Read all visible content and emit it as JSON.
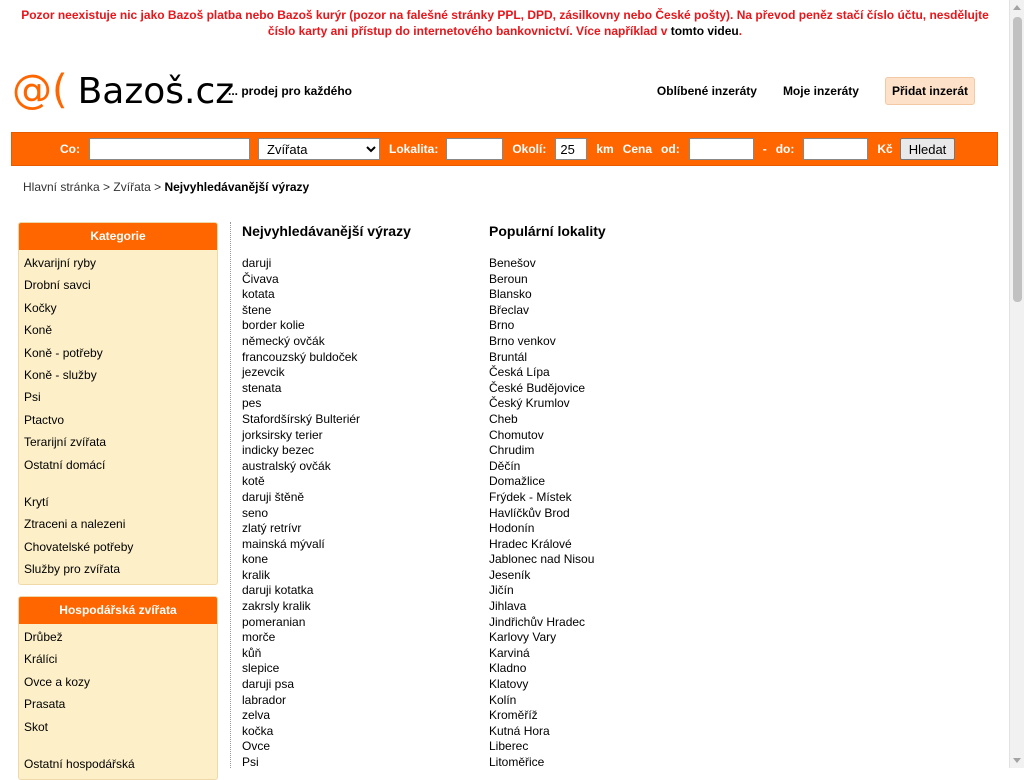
{
  "warning": {
    "text": "Pozor neexistuje nic jako Bazoš platba nebo Bazoš kurýr (pozor na falešné stránky PPL, DPD, zásilkovny nebo České pošty). Na převod peněz stačí číslo účtu, nesdělujte číslo karty ani přístup do internetového bankovnictví. Více například v",
    "link": "tomto videu",
    "end": "."
  },
  "header": {
    "logo_at": "@(",
    "logo_text": "Bazoš.cz",
    "tagline": "... prodej pro každého",
    "nav": {
      "favorites": "Oblíbené inzeráty",
      "my_ads": "Moje inzeráty",
      "add_ad": "Přidat inzerát"
    }
  },
  "search": {
    "what_label": "Co:",
    "what_value": "",
    "category_selected": "Zvířata",
    "location_label": "Lokalita:",
    "location_value": "",
    "radius_label": "Okolí:",
    "radius_value": "25",
    "km_label": "km",
    "price_label": "Cena",
    "from_label": "od:",
    "from_value": "",
    "dash": "-",
    "to_label": "do:",
    "to_value": "",
    "currency": "Kč",
    "button": "Hledat"
  },
  "breadcrumb": {
    "home": "Hlavní stránka",
    "sep1": ">",
    "section": "Zvířata",
    "sep2": ">",
    "current": "Nejvyhledávanější výrazy"
  },
  "sidebar": {
    "categories": {
      "title": "Kategorie",
      "items": [
        "Akvarijní ryby",
        "Drobní savci",
        "Kočky",
        "Koně",
        "Koně - potřeby",
        "Koně - služby",
        "Psi",
        "Ptactvo",
        "Terarijní zvířata",
        "Ostatní domácí",
        "",
        "Krytí",
        "Ztraceni a nalezeni",
        "Chovatelské potřeby",
        "Služby pro zvířata"
      ]
    },
    "farm": {
      "title": "Hospodářská zvířata",
      "items": [
        "Drůbež",
        "Králíci",
        "Ovce a kozy",
        "Prasata",
        "Skot",
        "",
        "Ostatní hospodářská"
      ]
    }
  },
  "main": {
    "searches_title": "Nejvyhledávanější výrazy",
    "searches": [
      "daruji",
      "Čivava",
      "kotata",
      "štene",
      "border kolie",
      "německý ovčák",
      "francouzský buldoček",
      "jezevcik",
      "stenata",
      "pes",
      "Stafordšírský Bulteriér",
      "jorksirsky terier",
      "indicky bezec",
      "australský ovčák",
      "kotě",
      "daruji štěně",
      "seno",
      "zlatý retrívr",
      "mainská mývalí",
      "kone",
      "kralik",
      "daruji kotatka",
      "zakrsly kralik",
      "pomeranian",
      "morče",
      "kůň",
      "slepice",
      "daruji psa",
      "labrador",
      "zelva",
      "kočka",
      "Ovce",
      "Psi"
    ],
    "locations_title": "Populární lokality",
    "locations": [
      "Benešov",
      "Beroun",
      "Blansko",
      "Břeclav",
      "Brno",
      "Brno venkov",
      "Bruntál",
      "Česká Lípa",
      "České Budějovice",
      "Český Krumlov",
      "Cheb",
      "Chomutov",
      "Chrudim",
      "Děčín",
      "Domažlice",
      "Frýdek - Místek",
      "Havlíčkův Brod",
      "Hodonín",
      "Hradec Králové",
      "Jablonec nad Nisou",
      "Jeseník",
      "Jičín",
      "Jihlava",
      "Jindřichův Hradec",
      "Karlovy Vary",
      "Karviná",
      "Kladno",
      "Klatovy",
      "Kolín",
      "Kroměříž",
      "Kutná Hora",
      "Liberec",
      "Litoměřice"
    ]
  },
  "colors": {
    "accent": "#ff6600",
    "warning": "#e8161b",
    "sidebar_bg": "#fdf0c8"
  }
}
